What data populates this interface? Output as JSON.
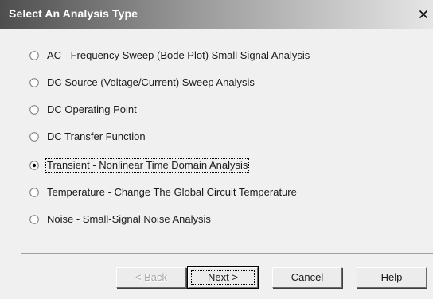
{
  "window": {
    "title": "Select An Analysis Type",
    "close_glyph": "✕"
  },
  "options": [
    {
      "label": "AC - Frequency Sweep (Bode Plot) Small Signal Analysis",
      "selected": false
    },
    {
      "label": "DC Source (Voltage/Current) Sweep Analysis",
      "selected": false
    },
    {
      "label": "DC Operating Point",
      "selected": false
    },
    {
      "label": "DC Transfer Function",
      "selected": false
    },
    {
      "label": "Transient - Nonlinear Time Domain Analysis",
      "selected": true
    },
    {
      "label": "Temperature - Change The Global Circuit Temperature",
      "selected": false
    },
    {
      "label": "Noise - Small-Signal Noise Analysis",
      "selected": false
    }
  ],
  "buttons": {
    "back": "< Back",
    "next": "Next >",
    "cancel": "Cancel",
    "help": "Help"
  },
  "colors": {
    "title_gradient_start": "#4e4e4e",
    "title_gradient_end": "#e6e6e6",
    "dialog_background": "#f0f0f0"
  }
}
